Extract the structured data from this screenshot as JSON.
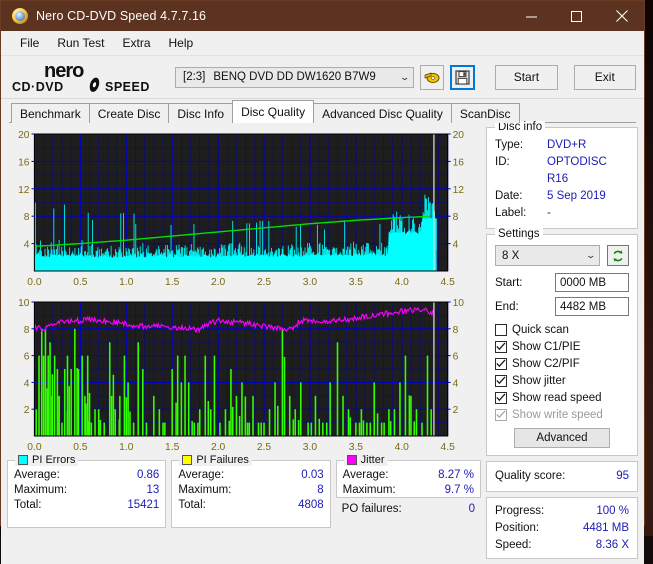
{
  "window": {
    "title": "Nero CD-DVD Speed 4.7.7.16",
    "icon": "nero-disc-icon",
    "minimize_label": "–",
    "maximize_label": "☐",
    "close_label": "✕",
    "titlebar_color": "#5c3220"
  },
  "menu": {
    "items": [
      {
        "label": "File"
      },
      {
        "label": "Run Test"
      },
      {
        "label": "Extra"
      },
      {
        "label": "Help"
      }
    ]
  },
  "toolbar": {
    "logo_line1": "nero",
    "logo_line2": "CD·DVD SPEED",
    "drive_index": "[2:3]",
    "drive_name": "BENQ DVD DD DW1620 B7W9",
    "dropdown_chevron": "⌄",
    "eject_icon": "eject-disc-icon",
    "save_icon": "floppy-save-icon",
    "start_label": "Start",
    "exit_label": "Exit"
  },
  "tabs": [
    {
      "label": "Benchmark",
      "active": false
    },
    {
      "label": "Create Disc",
      "active": false
    },
    {
      "label": "Disc Info",
      "active": false
    },
    {
      "label": "Disc Quality",
      "active": true
    },
    {
      "label": "Advanced Disc Quality",
      "active": false
    },
    {
      "label": "ScanDisc",
      "active": false
    }
  ],
  "disc_info": {
    "legend": "Disc info",
    "rows": [
      {
        "key": "Type:",
        "value": "DVD+R"
      },
      {
        "key": "ID:",
        "value": "OPTODISC R16"
      },
      {
        "key": "Date:",
        "value": "5 Sep 2019"
      },
      {
        "key": "Label:",
        "value": "-"
      }
    ]
  },
  "settings": {
    "legend": "Settings",
    "speed_value": "8 X",
    "speed_chevron": "⌄",
    "refresh_icon": "refresh-arrows-icon",
    "start_label": "Start:",
    "start_value": "0000 MB",
    "end_label": "End:",
    "end_value": "4482 MB",
    "checkboxes": [
      {
        "label": "Quick scan",
        "checked": false,
        "disabled": false
      },
      {
        "label": "Show C1/PIE",
        "checked": true,
        "disabled": false
      },
      {
        "label": "Show C2/PIF",
        "checked": true,
        "disabled": false
      },
      {
        "label": "Show jitter",
        "checked": true,
        "disabled": false
      },
      {
        "label": "Show read speed",
        "checked": true,
        "disabled": false
      },
      {
        "label": "Show write speed",
        "checked": true,
        "disabled": true
      }
    ],
    "advanced_label": "Advanced"
  },
  "quality": {
    "label": "Quality score:",
    "value": "95"
  },
  "progress": {
    "rows": [
      {
        "key": "Progress:",
        "value": "100 %"
      },
      {
        "key": "Position:",
        "value": "4481 MB"
      },
      {
        "key": "Speed:",
        "value": "8.36 X"
      }
    ]
  },
  "stats": {
    "pi_errors": {
      "legend": "PI Errors",
      "swatch": "#00ffff",
      "rows": [
        {
          "key": "Average:",
          "value": "0.86"
        },
        {
          "key": "Maximum:",
          "value": "13"
        },
        {
          "key": "Total:",
          "value": "15421"
        }
      ]
    },
    "pi_failures": {
      "legend": "PI Failures",
      "swatch": "#ffff00",
      "rows": [
        {
          "key": "Average:",
          "value": "0.03"
        },
        {
          "key": "Maximum:",
          "value": "8"
        },
        {
          "key": "Total:",
          "value": "4808"
        }
      ]
    },
    "jitter": {
      "legend": "Jitter",
      "swatch": "#ff00ff",
      "rows": [
        {
          "key": "Average:",
          "value": "8.27 %"
        },
        {
          "key": "Maximum:",
          "value": "9.7 %"
        }
      ],
      "po_key": "PO failures:",
      "po_value": "0"
    }
  },
  "chart_data": [
    {
      "id": "pi-errors-graph",
      "type": "area",
      "title": "PI Errors / read speed vs disc position",
      "xlabel": "",
      "ylabel": "",
      "xlim": [
        0.0,
        4.5
      ],
      "ylim": [
        0,
        20
      ],
      "xticks": [
        0.0,
        0.5,
        1.0,
        1.5,
        2.0,
        2.5,
        3.0,
        3.5,
        4.0,
        4.5
      ],
      "xtick_labels": [
        "0.0",
        "0.5",
        "1.0",
        "1.5",
        "2.0",
        "2.5",
        "3.0",
        "3.5",
        "4.0",
        "4.5"
      ],
      "yticks": [
        0,
        4,
        8,
        12,
        16,
        20
      ],
      "ytick_labels": [
        "",
        "4",
        "8",
        "12",
        "16",
        "20"
      ],
      "right_yticks": [
        0,
        4,
        8,
        12,
        16,
        20
      ],
      "right_ytick_labels": [
        "",
        "4",
        "8",
        "12",
        "16",
        "20"
      ],
      "grid": true,
      "plot_bg": "#1e1e1e",
      "grid_color": "#0000c8",
      "series": [
        {
          "name": "PI Errors",
          "color": "#00ffff",
          "type": "spiky-area",
          "note": "cyan filled baseline with dense vertical spikes, avg 0.86, max 13, rises after 3.85",
          "baseline": 2.2,
          "segments": [
            {
              "x_start": 0.0,
              "x_end": 0.55,
              "base": 2.3,
              "spike_mean": 3.8,
              "spike_max": 10.0
            },
            {
              "x_start": 0.55,
              "x_end": 1.1,
              "base": 2.2,
              "spike_mean": 3.3,
              "spike_max": 8.7
            },
            {
              "x_start": 1.1,
              "x_end": 2.0,
              "base": 2.2,
              "spike_mean": 3.4,
              "spike_max": 7.0
            },
            {
              "x_start": 2.0,
              "x_end": 3.0,
              "base": 2.3,
              "spike_mean": 3.5,
              "spike_max": 7.5
            },
            {
              "x_start": 3.0,
              "x_end": 3.85,
              "base": 2.4,
              "spike_mean": 3.6,
              "spike_max": 7.5
            },
            {
              "x_start": 3.85,
              "x_end": 4.22,
              "base": 5.6,
              "spike_mean": 6.6,
              "spike_max": 10.0
            },
            {
              "x_start": 4.22,
              "x_end": 4.38,
              "base": 7.6,
              "spike_mean": 9.5,
              "spike_max": 13.0
            }
          ]
        },
        {
          "name": "Read speed",
          "color": "#00e000",
          "type": "line",
          "x": [
            0.0,
            0.5,
            1.0,
            1.5,
            2.0,
            2.5,
            3.0,
            3.5,
            4.0,
            4.35
          ],
          "values": [
            3.6,
            4.0,
            4.5,
            5.1,
            5.7,
            6.3,
            6.9,
            7.4,
            7.8,
            8.0
          ]
        }
      ],
      "cursor_x": 4.35,
      "cursor_color": "#d8d8d8"
    },
    {
      "id": "pi-failures-graph",
      "type": "bar",
      "title": "PI Failures / jitter vs disc position",
      "xlabel": "",
      "ylabel": "",
      "xlim": [
        0.0,
        4.5
      ],
      "ylim": [
        0,
        10
      ],
      "xticks": [
        0.0,
        0.5,
        1.0,
        1.5,
        2.0,
        2.5,
        3.0,
        3.5,
        4.0,
        4.5
      ],
      "xtick_labels": [
        "0.0",
        "0.5",
        "1.0",
        "1.5",
        "2.0",
        "2.5",
        "3.0",
        "3.5",
        "4.0",
        "4.5"
      ],
      "yticks": [
        0,
        2,
        4,
        6,
        8,
        10
      ],
      "ytick_labels": [
        "",
        "2",
        "4",
        "6",
        "8",
        "10"
      ],
      "right_yticks": [
        0,
        2,
        4,
        6,
        8,
        10
      ],
      "right_ytick_labels": [
        "",
        "2",
        "4",
        "6",
        "8",
        "10"
      ],
      "grid": true,
      "plot_bg": "#1e1e1e",
      "grid_color": "#0000c8",
      "series": [
        {
          "name": "PI Failures",
          "color": "#33ff00",
          "type": "spikes",
          "note": "sparse bright-green vertical spikes, avg 0.03, max 8, total 4808",
          "x": [
            0.02,
            0.05,
            0.08,
            0.1,
            0.12,
            0.15,
            0.17,
            0.19,
            0.22,
            0.25,
            0.27,
            0.3,
            0.33,
            0.36,
            0.4,
            0.44,
            0.48,
            0.52,
            0.55,
            0.58,
            0.62,
            0.66,
            0.7,
            0.76,
            0.82,
            0.84,
            0.88,
            0.93,
            0.98,
            1.02,
            1.08,
            1.13,
            1.18,
            1.22,
            1.3,
            1.36,
            1.42,
            1.5,
            1.56,
            1.6,
            1.64,
            1.68,
            1.74,
            1.8,
            1.86,
            1.92,
            1.96,
            2.02,
            2.08,
            2.14,
            2.2,
            2.26,
            2.32,
            2.38,
            2.44,
            2.5,
            2.56,
            2.62,
            2.7,
            2.78,
            2.84,
            2.9,
            2.98,
            3.06,
            3.14,
            3.22,
            3.3,
            3.36,
            3.42,
            3.5,
            3.56,
            3.62,
            3.7,
            3.78,
            3.86,
            3.92,
            3.98,
            4.04,
            4.1,
            4.16,
            4.22,
            4.28,
            4.32
          ],
          "values": [
            2,
            6,
            8,
            6,
            8,
            6,
            7,
            3,
            6,
            5,
            3,
            1,
            5,
            6,
            5,
            8,
            5,
            6,
            3,
            6,
            1,
            2,
            2,
            1,
            7,
            3,
            2,
            3,
            6,
            4,
            1,
            7,
            5,
            1,
            3,
            2,
            1,
            5,
            6,
            4,
            6,
            4,
            1,
            2,
            6,
            2,
            6,
            1,
            2,
            5,
            3,
            4,
            1,
            3,
            1,
            1,
            2,
            4,
            8,
            3,
            2,
            4,
            1,
            3,
            1,
            4,
            7,
            3,
            2,
            1,
            2,
            1,
            4,
            1,
            2,
            2,
            4,
            6,
            3,
            2,
            1,
            6,
            2
          ]
        },
        {
          "name": "Jitter",
          "color": "#ff00ff",
          "type": "line",
          "note": "noisy magenta jitter trace, avg 8.27 %, max 9.7 %",
          "x": [
            0.0,
            0.1,
            0.2,
            0.3,
            0.4,
            0.5,
            0.6,
            0.7,
            0.8,
            0.9,
            1.0,
            1.1,
            1.2,
            1.3,
            1.4,
            1.5,
            1.6,
            1.7,
            1.8,
            1.9,
            2.0,
            2.1,
            2.2,
            2.3,
            2.4,
            2.5,
            2.6,
            2.7,
            2.8,
            2.9,
            3.0,
            3.1,
            3.2,
            3.3,
            3.4,
            3.5,
            3.6,
            3.7,
            3.8,
            3.9,
            4.0,
            4.1,
            4.2,
            4.3,
            4.35
          ],
          "values": [
            8.1,
            8.0,
            8.3,
            8.5,
            8.6,
            8.6,
            8.7,
            8.6,
            8.6,
            8.5,
            8.4,
            8.2,
            8.2,
            8.2,
            8.2,
            8.1,
            8.1,
            8.0,
            7.9,
            8.4,
            8.6,
            8.5,
            8.5,
            8.4,
            8.3,
            8.2,
            8.1,
            8.0,
            8.0,
            8.6,
            8.7,
            8.6,
            8.6,
            8.6,
            8.7,
            8.8,
            8.9,
            9.0,
            9.1,
            9.2,
            9.3,
            9.4,
            9.4,
            9.3,
            9.2
          ]
        }
      ],
      "cursor_x": 4.35,
      "cursor_color": "#d8d8d8"
    }
  ]
}
